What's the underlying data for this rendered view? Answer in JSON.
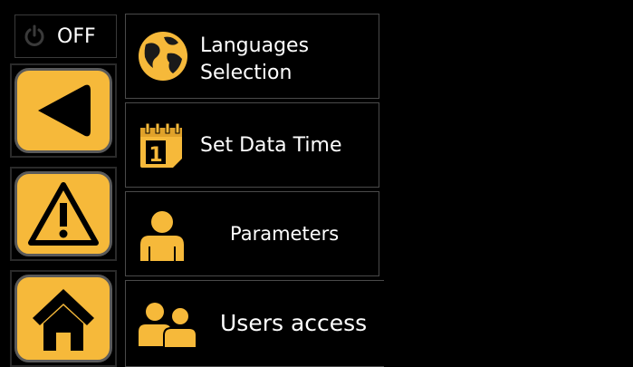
{
  "power": {
    "label": "OFF",
    "icon": "power-icon"
  },
  "side_buttons": [
    {
      "name": "back",
      "icon": "triangle-left-icon"
    },
    {
      "name": "warning",
      "icon": "warning-icon"
    },
    {
      "name": "home",
      "icon": "home-icon"
    }
  ],
  "menu": {
    "languages": {
      "line1": "Languages",
      "line2": "Selection",
      "icon": "globe-icon"
    },
    "date_time": {
      "label": "Set Data Time",
      "icon": "calendar-icon",
      "calendar_day": "1"
    },
    "parameters": {
      "label": "Parameters",
      "icon": "user-icon"
    },
    "users_access": {
      "label": "Users access",
      "icon": "users-icon"
    }
  },
  "colors": {
    "accent": "#f6b93a",
    "background": "#000000",
    "border": "#4a4a4a"
  }
}
